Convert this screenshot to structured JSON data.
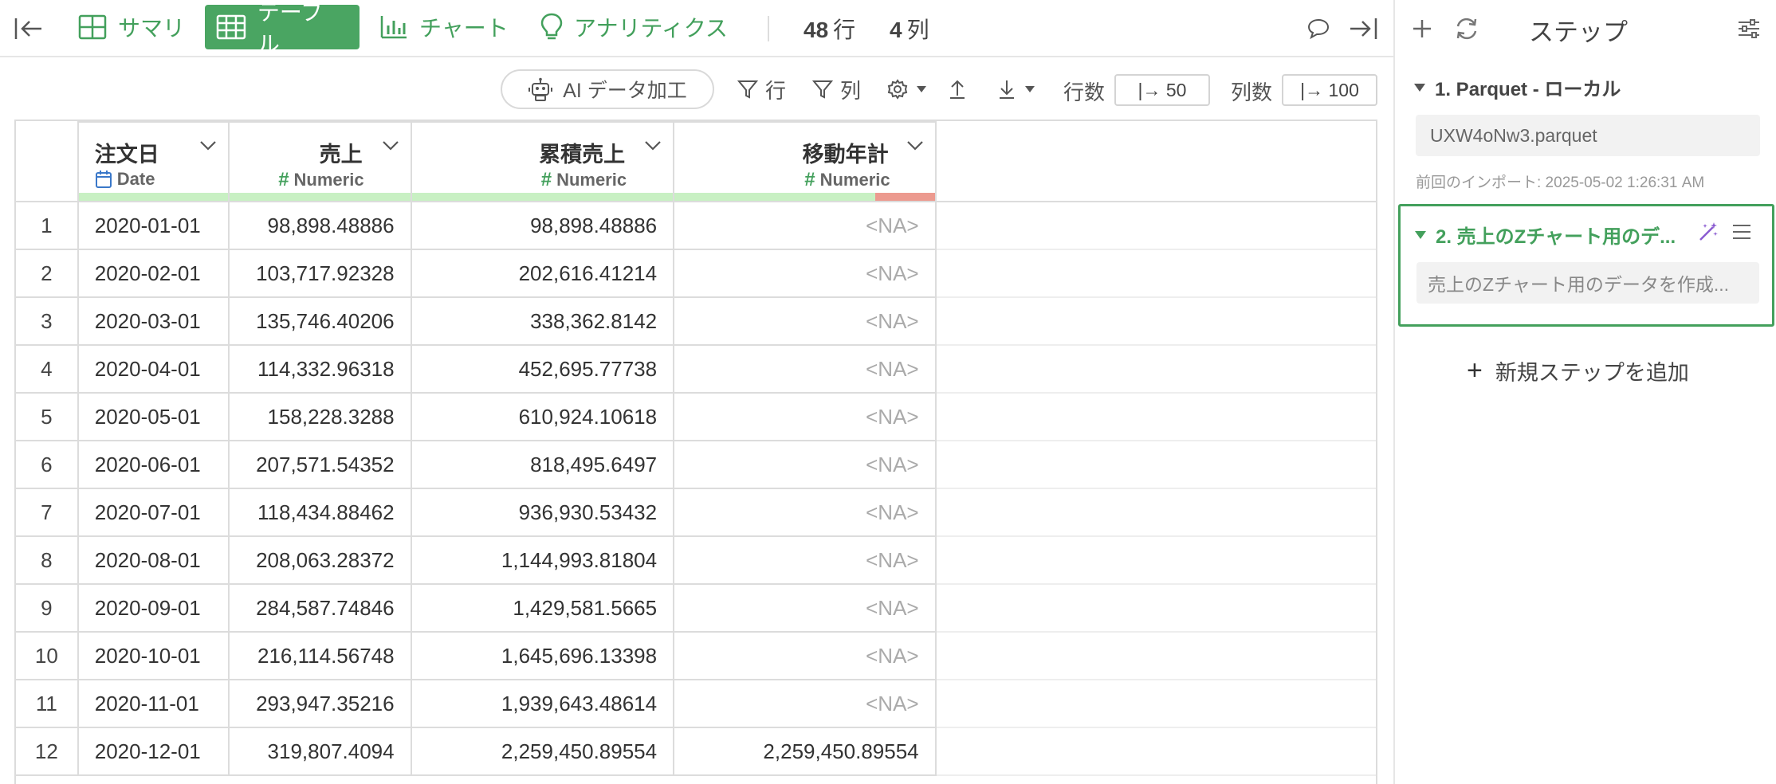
{
  "tabs": [
    {
      "label": "サマリ",
      "icon": "summary-grid-icon",
      "active": false
    },
    {
      "label": "テーブル",
      "icon": "table-icon",
      "active": true
    },
    {
      "label": "チャート",
      "icon": "bar-chart-icon",
      "active": false
    },
    {
      "label": "アナリティクス",
      "icon": "lightbulb-icon",
      "active": false
    }
  ],
  "counts": {
    "rows_value": "48",
    "rows_unit": "行",
    "cols_value": "4",
    "cols_unit": "列"
  },
  "toolbar": {
    "ai_label": "AI データ加工",
    "filter_row_label": "行",
    "filter_col_label": "列",
    "rows_label": "行数",
    "rows_value": "|→ 50",
    "cols_label": "列数",
    "cols_value": "|→ 100"
  },
  "columns": [
    {
      "name": "注文日",
      "type": "Date",
      "type_icon": "calendar-icon"
    },
    {
      "name": "売上",
      "type": "Numeric",
      "type_icon": "hash-icon"
    },
    {
      "name": "累積売上",
      "type": "Numeric",
      "type_icon": "hash-icon"
    },
    {
      "name": "移動年計",
      "type": "Numeric",
      "type_icon": "hash-icon"
    }
  ],
  "missing_ratio": {
    "移動年計": 0.23
  },
  "rows": [
    [
      "1",
      "2020-01-01",
      "98,898.48886",
      "98,898.48886",
      "<NA>"
    ],
    [
      "2",
      "2020-02-01",
      "103,717.92328",
      "202,616.41214",
      "<NA>"
    ],
    [
      "3",
      "2020-03-01",
      "135,746.40206",
      "338,362.8142",
      "<NA>"
    ],
    [
      "4",
      "2020-04-01",
      "114,332.96318",
      "452,695.77738",
      "<NA>"
    ],
    [
      "5",
      "2020-05-01",
      "158,228.3288",
      "610,924.10618",
      "<NA>"
    ],
    [
      "6",
      "2020-06-01",
      "207,571.54352",
      "818,495.6497",
      "<NA>"
    ],
    [
      "7",
      "2020-07-01",
      "118,434.88462",
      "936,930.53432",
      "<NA>"
    ],
    [
      "8",
      "2020-08-01",
      "208,063.28372",
      "1,144,993.81804",
      "<NA>"
    ],
    [
      "9",
      "2020-09-01",
      "284,587.74846",
      "1,429,581.5665",
      "<NA>"
    ],
    [
      "10",
      "2020-10-01",
      "216,114.56748",
      "1,645,696.13398",
      "<NA>"
    ],
    [
      "11",
      "2020-11-01",
      "293,947.35216",
      "1,939,643.48614",
      "<NA>"
    ],
    [
      "12",
      "2020-12-01",
      "319,807.4094",
      "2,259,450.89554",
      "2,259,450.89554"
    ]
  ],
  "panel": {
    "title": "ステップ",
    "step1": {
      "label": "1. Parquet - ローカル",
      "file": "UXW4oNw3.parquet",
      "imported": "前回のインポート: 2025-05-02 1:26:31 AM"
    },
    "step2": {
      "label": "2. 売上のZチャート用のデ...",
      "desc": "売上のZチャート用のデータを作成..."
    },
    "add_step": "新規ステップを追加"
  },
  "colors": {
    "accent": "#4aa562",
    "na_bar": "#ec9a8f",
    "valid_bar": "#c8f0c3"
  }
}
